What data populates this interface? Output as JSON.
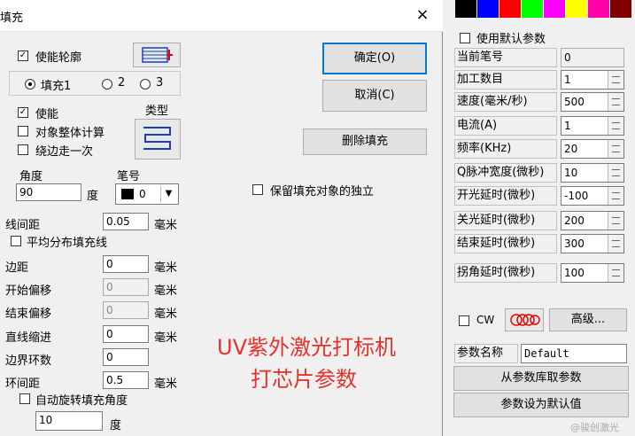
{
  "dialog": {
    "title": "填充",
    "close_icon": "×",
    "enable_contour": "使能轮廓",
    "fill_radios": [
      "填充1",
      "2",
      "3"
    ],
    "enable": "使能",
    "type_label": "类型",
    "whole_calc": "对象整体计算",
    "edge_once": "绕边走一次",
    "angle_label": "角度",
    "angle_value": "90",
    "degree_unit": "度",
    "pen_label": "笔号",
    "pen_value": "0",
    "line_spacing_label": "线间距",
    "line_spacing_value": "0.05",
    "mm_unit": "毫米",
    "avg_distribute": "平均分布填充线",
    "margin_label": "边距",
    "margin_value": "0",
    "start_offset_label": "开始偏移",
    "start_offset_value": "0",
    "end_offset_label": "结束偏移",
    "end_offset_value": "0",
    "line_shrink_label": "直线缩进",
    "line_shrink_value": "0",
    "border_rings_label": "边界环数",
    "border_rings_value": "0",
    "ring_spacing_label": "环间距",
    "ring_spacing_value": "0.5",
    "auto_rotate": "自动旋转填充角度",
    "rotate_value": "10",
    "ok_button": "确定(O)",
    "cancel_button": "取消(C)",
    "delete_fill_button": "删除填充",
    "keep_independent": "保留填充对象的独立",
    "overlay_line1": "UV紫外激光打标机",
    "overlay_line2": "打芯片参数"
  },
  "params": {
    "colors": [
      "#000000",
      "#0000ff",
      "#ff0000",
      "#00ff00",
      "#ff00ff",
      "#ffff00",
      "#ff00aa",
      "#800000"
    ],
    "use_default": "使用默认参数",
    "rows": [
      {
        "label": "当前笔号",
        "value": "0",
        "spin": false
      },
      {
        "label": "加工数目",
        "value": "1",
        "spin": true
      },
      {
        "label": "速度(毫米/秒)",
        "value": "500",
        "spin": true
      },
      {
        "label": "电流(A)",
        "value": "1",
        "spin": true
      },
      {
        "label": "频率(KHz)",
        "value": "20",
        "spin": true
      },
      {
        "label": "Q脉冲宽度(微秒)",
        "value": "10",
        "spin": true
      },
      {
        "label": "开光延时(微秒)",
        "value": "-100",
        "spin": true
      },
      {
        "label": "关光延时(微秒)",
        "value": "200",
        "spin": true
      },
      {
        "label": "结束延时(微秒)",
        "value": "300",
        "spin": true
      },
      {
        "label": "拐角延时(微秒)",
        "value": "100",
        "spin": true
      }
    ],
    "cw": "CW",
    "advanced_button": "高级...",
    "param_name_label": "参数名称",
    "param_name_value": "Default",
    "from_library_button": "从参数库取参数",
    "set_default_button": "参数设为默认值",
    "watermark": "@骏创激光"
  }
}
